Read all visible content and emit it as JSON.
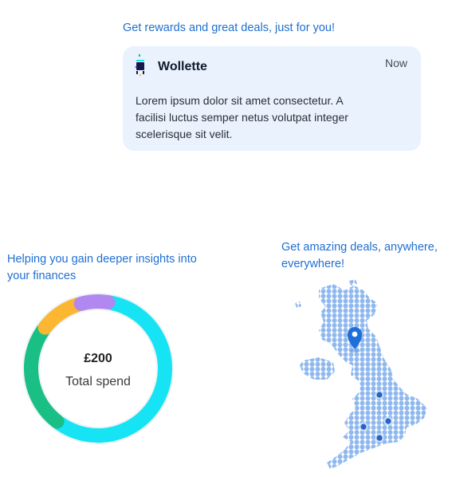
{
  "notification": {
    "tagline": "Get rewards and great deals, just for you!",
    "app_name": "Wollette",
    "time": "Now",
    "body": "Lorem ipsum dolor sit amet consectetur. A facilisi luctus semper netus volutpat integer scelerisque sit velit.",
    "logo_icon": "wollette-logo-icon"
  },
  "insights": {
    "tagline": "Helping you gain deeper insights into your finances",
    "amount": "£200",
    "label": "Total spend"
  },
  "chart_data": {
    "type": "pie",
    "values": [
      55,
      24,
      10,
      7
    ],
    "colors": [
      "#16e3f3",
      "#1abf86",
      "#fbb732",
      "#b187f0"
    ]
  },
  "deals": {
    "tagline": "Get amazing deals, anywhere, everywhere!",
    "map_icon": "uk-map-icon",
    "pin_icon": "location-pin-icon",
    "colors": {
      "map_fill": "#8fb8ef",
      "pin": "#1e6fd9",
      "dot": "#2463c8"
    }
  }
}
